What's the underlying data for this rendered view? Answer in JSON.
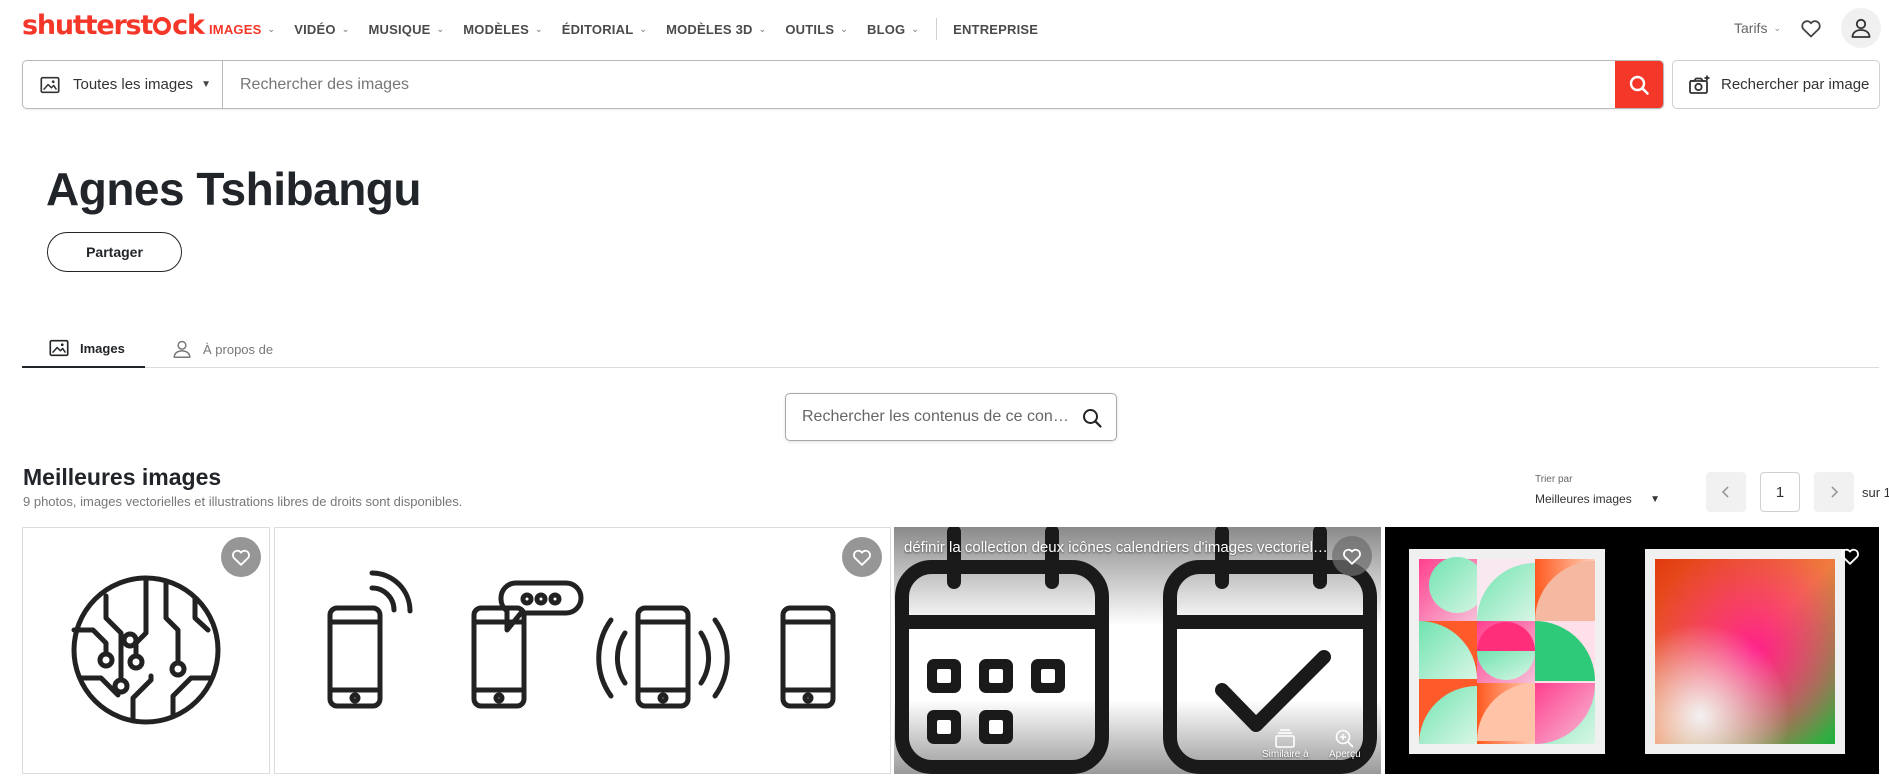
{
  "header": {
    "logo_text": "shutterstock",
    "nav": [
      {
        "label": "IMAGES",
        "active": true,
        "has_chevron": true
      },
      {
        "label": "VIDÉO",
        "active": false,
        "has_chevron": true
      },
      {
        "label": "MUSIQUE",
        "active": false,
        "has_chevron": true
      },
      {
        "label": "MODÈLES",
        "active": false,
        "has_chevron": true
      },
      {
        "label": "ÉDITORIAL",
        "active": false,
        "has_chevron": true
      },
      {
        "label": "MODÈLES 3D",
        "active": false,
        "has_chevron": true
      },
      {
        "label": "OUTILS",
        "active": false,
        "has_chevron": true
      },
      {
        "label": "BLOG",
        "active": false,
        "has_chevron": true
      }
    ],
    "enterprise_label": "ENTREPRISE",
    "pricing_label": "Tarifs",
    "icons": {
      "favorites": "heart-icon",
      "account": "user-icon"
    }
  },
  "search": {
    "scope_label": "Toutes les images",
    "placeholder": "Rechercher des images",
    "image_search_label": "Rechercher par image"
  },
  "profile": {
    "name": "Agnes Tshibangu",
    "share_label": "Partager"
  },
  "tabs": [
    {
      "label": "Images",
      "active": true,
      "icon": "image-icon"
    },
    {
      "label": "À propos de",
      "active": false,
      "icon": "user-icon"
    }
  ],
  "contributor_search": {
    "placeholder": "Rechercher les contenus de ce cont…"
  },
  "results": {
    "title": "Meilleures images",
    "subtitle": "9 photos, images vectorielles et illustrations libres de droits sont disponibles.",
    "sort_label": "Trier par",
    "sort_value": "Meilleures images",
    "page": "1",
    "page_total": "sur 1"
  },
  "tiles": [
    {
      "kind": "circuit-globe-icon"
    },
    {
      "kind": "smartphone-icons"
    },
    {
      "kind": "calendar-icons",
      "caption": "définir la collection deux icônes calendriers d'images vectorielles",
      "action_similar": "Similaire à",
      "action_preview": "Aperçu"
    },
    {
      "kind": "abstract-posters"
    }
  ],
  "colors": {
    "brand": "#f5372a",
    "text": "#212529",
    "muted": "#777777"
  }
}
